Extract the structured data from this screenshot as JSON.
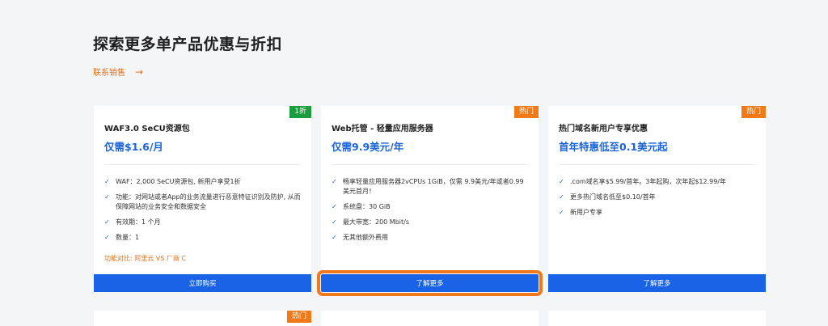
{
  "section": {
    "title": "探索更多单产品优惠与折扣",
    "contact_label": "联系销售",
    "contact_arrow": "→"
  },
  "cards": [
    {
      "badge": "1折",
      "badge_color": "#1c9c3c",
      "title": "WAF3.0 SeCU资源包",
      "price": "仅需$1.6/月",
      "features": [
        "WAF：2,000 SeCU资源包, 新用户享受1折",
        "功能：对网站或者App的业务流量进行恶意特征识别及防护, 从而保障网站的业务安全和数据安全",
        "有效期：1 个月",
        "数量：1"
      ],
      "compare": "功能对比: 阿里云 VS 厂商 C",
      "button": "立即购买"
    },
    {
      "badge": "热门",
      "badge_color": "#ef7a17",
      "title": "Web托管 - 轻量应用服务器",
      "price": "仅需9.9美元/年",
      "features": [
        "畅享轻量应用服务器2vCPUs 1GiB，仅需 9.9美元/年或者0.99美元首月！",
        "系统盘：30 GiB",
        "最大带宽：200 Mbit/s",
        "无其他额外费用"
      ],
      "button": "了解更多"
    },
    {
      "badge": "热门",
      "badge_color": "#ef7a17",
      "title": "热门域名新用户专享优惠",
      "price": "首年特惠低至0.1美元起",
      "features": [
        ".com域名享$5.99/首年。3年起购，次年起$12.99/年",
        "更多热门域名低至$0.10/首年",
        "新用户专享"
      ],
      "button": "了解更多"
    }
  ],
  "bottom_cards": [
    {
      "badge": "热门"
    },
    {
      "badge": ""
    },
    {
      "badge": ""
    }
  ],
  "colors": {
    "accent_blue": "#1a63e6",
    "accent_orange": "#ef7a17",
    "badge_green": "#1c9c3c",
    "highlight_outline": "#f2781e"
  },
  "icons": {
    "check": "check-icon",
    "arrow": "arrow-right-icon"
  }
}
